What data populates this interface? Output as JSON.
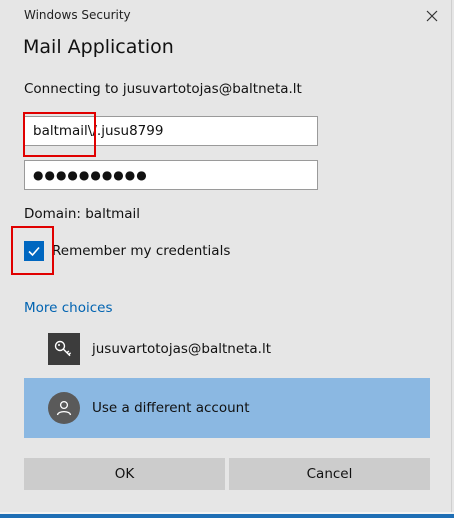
{
  "window": {
    "title": "Windows Security",
    "close_icon": "close-icon"
  },
  "dialog": {
    "app_title": "Mail Application",
    "connecting_text": "Connecting to jusuvartotojas@baltneta.lt",
    "username_value": "baltmail\\/.jusu8799",
    "password_mask": "●●●●●●●●●●",
    "domain_text": "Domain: baltmail",
    "remember_label": "Remember my credentials",
    "remember_checked": true,
    "more_choices_label": "More choices"
  },
  "accounts": [
    {
      "label": "jusuvartotojas@baltneta.lt",
      "icon": "key-icon"
    },
    {
      "label": "Use a different account",
      "icon": "person-icon",
      "selected": true
    }
  ],
  "buttons": {
    "ok_label": "OK",
    "cancel_label": "Cancel"
  },
  "colors": {
    "accent": "#0067c0",
    "link": "#0063b1",
    "selected_row": "#8bb8e2",
    "highlight_box": "#e00000"
  }
}
